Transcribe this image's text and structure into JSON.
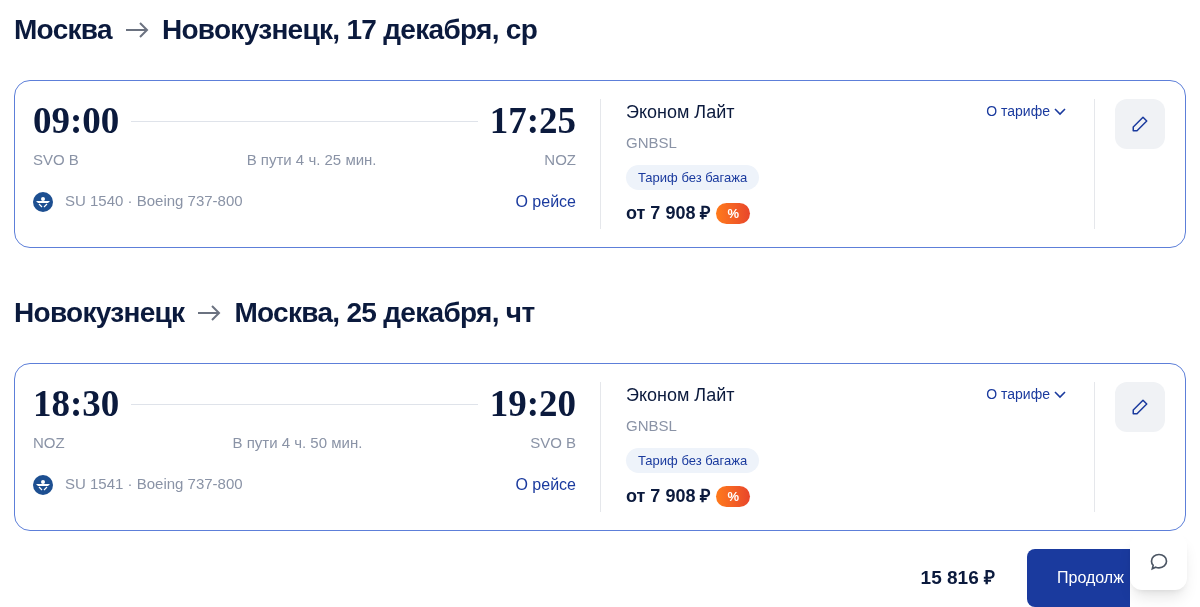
{
  "segments": [
    {
      "from": "Москва",
      "to": "Новокузнецк, 17 декабря, ср",
      "flight": {
        "depart_time": "09:00",
        "arrive_time": "17:25",
        "depart_airport": "SVO B",
        "arrive_airport": "NOZ",
        "duration": "В пути 4 ч. 25 мин.",
        "number": "SU 1540 · Boeing 737-800",
        "details_link": "О рейсе"
      },
      "fare": {
        "name": "Эконом Лайт",
        "code": "GNBSL",
        "tariff_link": "О тарифе",
        "tag": "Тариф без багажа",
        "price": "от 7 908 ₽",
        "discount": "%"
      }
    },
    {
      "from": "Новокузнецк",
      "to": "Москва, 25 декабря, чт",
      "flight": {
        "depart_time": "18:30",
        "arrive_time": "19:20",
        "depart_airport": "NOZ",
        "arrive_airport": "SVO B",
        "duration": "В пути 4 ч. 50 мин.",
        "number": "SU 1541 · Boeing 737-800",
        "details_link": "О рейсе"
      },
      "fare": {
        "name": "Эконом Лайт",
        "code": "GNBSL",
        "tariff_link": "О тарифе",
        "tag": "Тариф без багажа",
        "price": "от 7 908 ₽",
        "discount": "%"
      }
    }
  ],
  "footer": {
    "total": "15 816 ₽",
    "continue_button": "Продолж"
  }
}
